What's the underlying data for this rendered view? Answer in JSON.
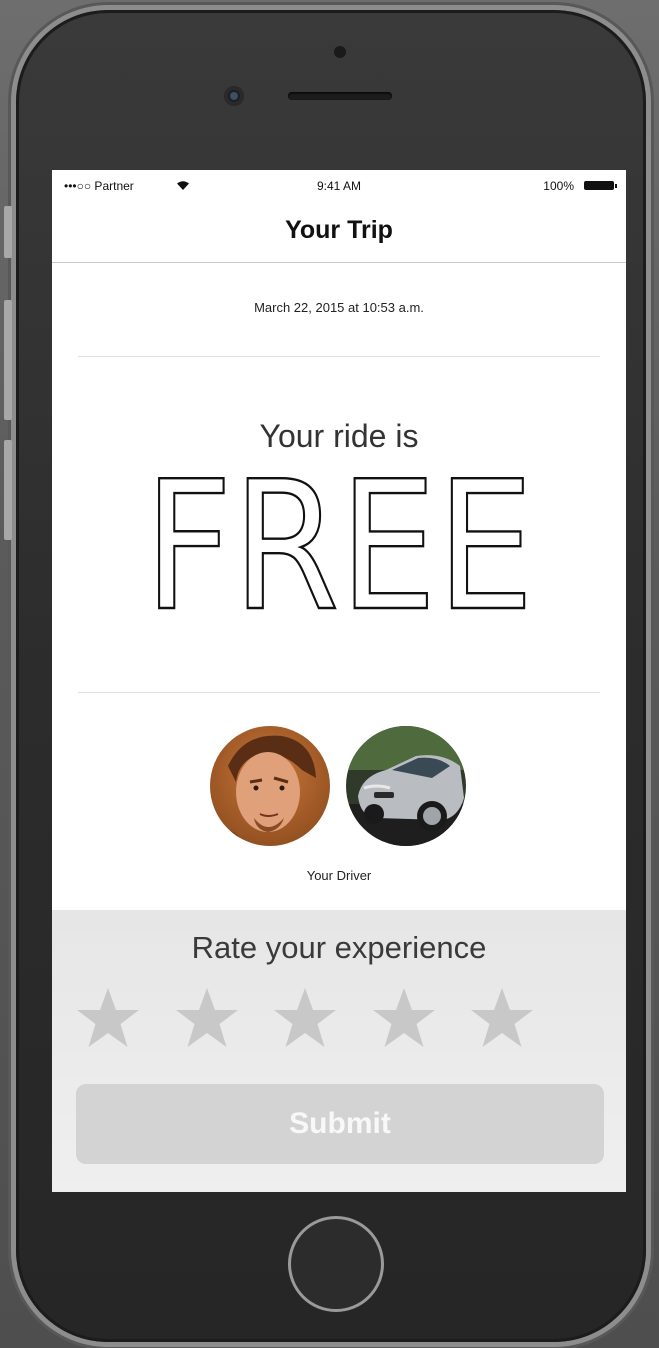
{
  "status_bar": {
    "carrier": "•••○○ Partner",
    "time": "9:41 AM",
    "battery": "100%"
  },
  "nav": {
    "title": "Your Trip"
  },
  "trip": {
    "date": "March 22, 2015 at 10:53 a.m.",
    "ride_label": "Your ride is",
    "fare": "FREE"
  },
  "driver": {
    "label": "Your Driver"
  },
  "rating": {
    "label": "Rate your experience",
    "stars": 5,
    "selected": 0,
    "star_color": "#c8c8c8"
  },
  "submit": {
    "label": "Submit"
  },
  "colors": {
    "screen_bg": "#ffffff",
    "panel_bg": "#e9e9e9",
    "button_bg": "#d3d3d3",
    "button_text": "#f8f8f8"
  }
}
